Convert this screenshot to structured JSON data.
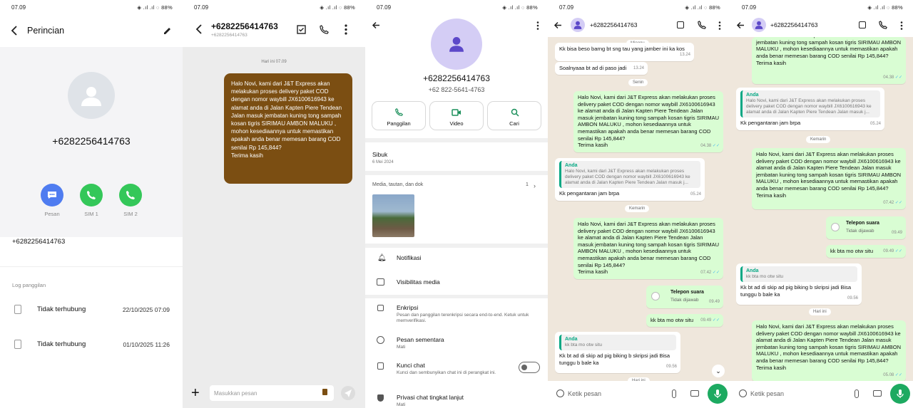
{
  "status": {
    "time": "07.09",
    "battery": "88%",
    "signal": "◈ .ıl .ıl"
  },
  "p1": {
    "title": "Perincian",
    "phone": "+6282256414763",
    "actions": [
      "Pesan",
      "SIM 1",
      "SIM 2"
    ],
    "number": "+6282256414763",
    "log_header": "Log panggilan",
    "log": [
      {
        "label": "Tidak terhubung",
        "date": "22/10/2025 07:09"
      },
      {
        "label": "Tidak terhubung",
        "date": "01/10/2025 11:26"
      }
    ]
  },
  "p2": {
    "title": "+6282256414763",
    "subtitle": "+6282256414763",
    "date": "Hari ini 07.09",
    "message": "Halo Novi, kami dari J&T Express akan melakukan proses delivery paket COD dengan nomor waybill JX6100616943 ke alamat anda di Jalan Kapten Piere Tendean  Jalan  masuk jembatan kuning tong sampah kosan tigris SIRIMAU AMBON MALUKU , mohon kesediaannya untuk memastikan apakah anda benar memesan barang COD senilai Rp 145,844?",
    "message_end": "Terima kasih",
    "input_placeholder": "Masukkan pesan"
  },
  "p3": {
    "phone": "+6282256414763",
    "phone2": "+62 822-5641-4763",
    "actions": [
      "Panggilan",
      "Video",
      "Cari"
    ],
    "status_title": "Sibuk",
    "status_date": "6 Mei 2024",
    "media_label": "Media, tautan, dan dok",
    "media_count": "1",
    "settings": [
      {
        "title": "Notifikasi",
        "sub": ""
      },
      {
        "title": "Visibilitas media",
        "sub": ""
      },
      {
        "title": "Enkripsi",
        "sub": "Pesan dan panggilan terenkripsi secara end-to-end. Ketuk untuk memverifikasi."
      },
      {
        "title": "Pesan sementara",
        "sub": "Mati"
      },
      {
        "title": "Kunci chat",
        "sub": "Kunci dan sembunyikan chat ini di perangkat ini."
      },
      {
        "title": "Privasi chat tingkat lanjut",
        "sub": "Mati"
      }
    ]
  },
  "wa": {
    "contact": "+6282256414763",
    "placeholder": "Ketik pesan",
    "p4": {
      "day_minggu": "Minggu",
      "m1": "Kk bisa beso barng bt sng tau yang jamber ini ka kos",
      "t1": "13.24",
      "m2": "Soalnyaaa bt ad di paso jadi",
      "t2": "13.24",
      "day_senin": "Senin",
      "long": "Halo Novi, kami dari J&T Express akan melakukan proses delivery paket COD dengan nomor waybill JX6100616943 ke alamat anda di Jalan Kapten Piere Tendean  Jalan  masuk jembatan kuning tong sampah kosan tigris SIRIMAU AMBON MALUKU , mohon kesediaannya untuk memastikan apakah anda benar memesan barang COD senilai Rp 145,844?",
      "long_end": "Terima kasih",
      "t3": "04.38",
      "quote_author": "Anda",
      "quote_text": "Halo Novi, kami dari J&T Express akan melakukan proses delivery paket COD dengan nomor waybill JX6100616943 ke alamat anda di Jalan Kapten Piere Tendean  Jalan  masuk j...",
      "reply1": "Kk pengantaran jam brpa",
      "t4": "05.24",
      "day_kemarin": "Kemarin",
      "t5": "07.42",
      "call_title": "Telepon suara",
      "call_sub": "Tidak dijawab",
      "t6": "09.49",
      "m7": "kk bta mo otw situ",
      "t7": "09.49",
      "quote2": "kk bta mo otw situ",
      "m8": "Kk bt ad di skip ad pig biking b skripsi jadi Bisa tunggu b bale ka",
      "t8": "09.56",
      "day_hari_ini": "Hari ini"
    },
    "p5": {
      "t1": "04.38",
      "reply1": "Kk pengantaran jam brpa",
      "t2": "05.24",
      "day_kemarin": "Kemarin",
      "t3": "07.42",
      "t4": "09.49",
      "t5": "09.49",
      "t6": "09.56",
      "day_hari_ini": "Hari ini",
      "t7": "05.08"
    }
  },
  "colors": {
    "wa_green": "#1daa61",
    "bubble_brown": "#7b4e12",
    "blue": "#4f7cf0",
    "green": "#34c759",
    "wa_bg": "#efe7dc"
  }
}
